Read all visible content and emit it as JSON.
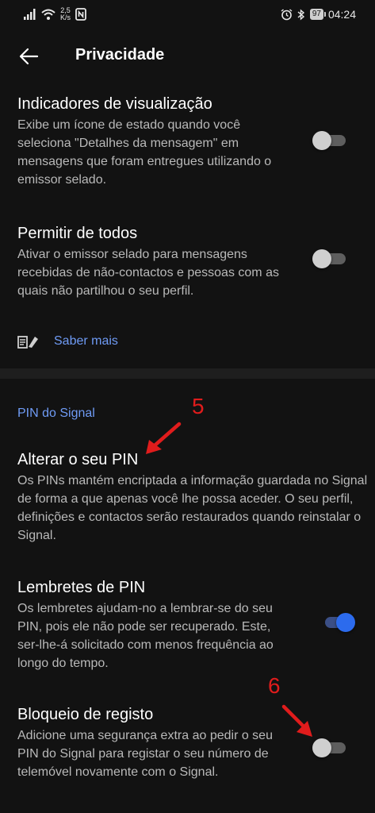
{
  "status_bar": {
    "speed_value": "2,5",
    "speed_unit": "K/s",
    "battery": "97",
    "time": "04:24",
    "icons": [
      "signal-icon",
      "wifi-icon",
      "nfc-icon",
      "alarm-icon",
      "bluetooth-icon",
      "battery-icon"
    ]
  },
  "header": {
    "title": "Privacidade",
    "back_icon": "arrow-left-icon"
  },
  "settings": {
    "view_indicators": {
      "title": "Indicadores de visualização",
      "description": "Exibe um ícone de estado quando você seleciona \"Detalhes da mensagem\" em mensagens que foram entregues utilizando o emissor selado.",
      "enabled": false
    },
    "allow_all": {
      "title": "Permitir de todos",
      "description": "Ativar o emissor selado para mensagens recebidas de não-contactos e pessoas com as quais não partilhou o seu perfil.",
      "enabled": false
    },
    "learn_more": {
      "label": "Saber mais",
      "icon": "sealed-sender-icon"
    }
  },
  "pin_section": {
    "header": "PIN do Signal",
    "change_pin": {
      "title": "Alterar o seu PIN",
      "description": "Os PINs mantém encriptada a informação guardada no Signal de forma a que apenas você lhe possa aceder. O seu perfil, definições e contactos serão restaurados quando reinstalar o Signal."
    },
    "pin_reminders": {
      "title": "Lembretes de PIN",
      "description": "Os lembretes ajudam-no a lembrar-se do seu PIN, pois ele não pode ser recuperado. Este, ser-lhe-á solicitado com menos frequência ao longo do tempo.",
      "enabled": true
    },
    "registration_lock": {
      "title": "Bloqueio de registo",
      "description": "Adicione uma segurança extra ao pedir o seu PIN do Signal para registar o seu número de telemóvel novamente com o Signal.",
      "enabled": false
    }
  },
  "annotations": {
    "marker_5": "5",
    "marker_6": "6",
    "color": "#e01c1c"
  },
  "colors": {
    "background": "#121212",
    "accent": "#2c6bed",
    "link": "#6f9bf5",
    "secondary_text": "#b9b9b9"
  }
}
